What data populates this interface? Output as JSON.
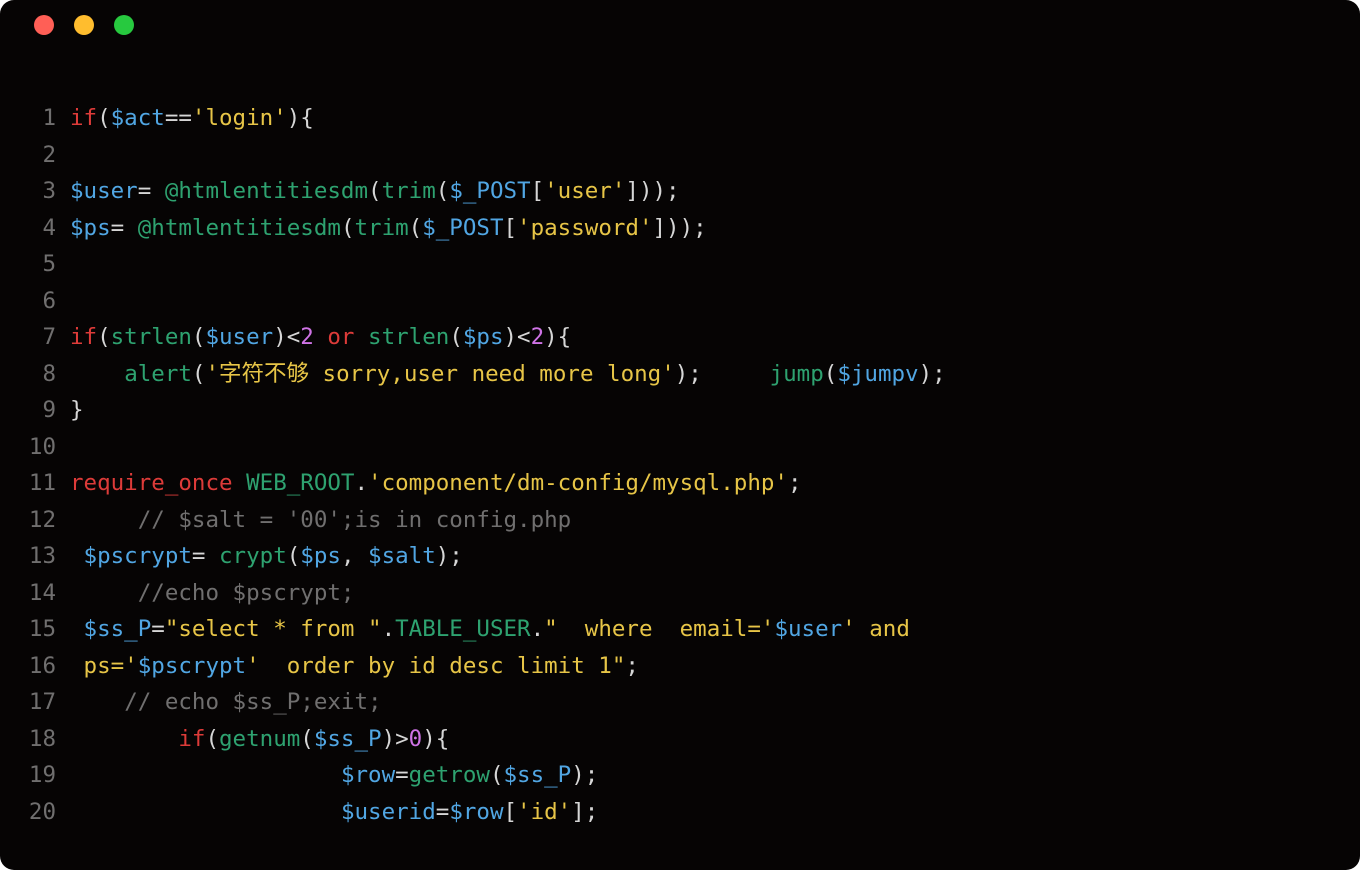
{
  "window": {
    "traffic_light": {
      "close": "red",
      "min": "yellow",
      "max": "green"
    }
  },
  "code": {
    "lines": [
      {
        "n": "1",
        "tokens": [
          [
            "kw",
            "if"
          ],
          [
            "punct",
            "("
          ],
          [
            "var",
            "$act"
          ],
          [
            "punct",
            "=="
          ],
          [
            "str",
            "'login'"
          ],
          [
            "punct",
            "){"
          ]
        ]
      },
      {
        "n": "2",
        "tokens": []
      },
      {
        "n": "3",
        "tokens": [
          [
            "var",
            "$user"
          ],
          [
            "punct",
            "= "
          ],
          [
            "at",
            "@htmlentitiesdm"
          ],
          [
            "punct",
            "("
          ],
          [
            "func",
            "trim"
          ],
          [
            "punct",
            "("
          ],
          [
            "var",
            "$_POST"
          ],
          [
            "punct",
            "["
          ],
          [
            "str",
            "'user'"
          ],
          [
            "punct",
            "]));"
          ]
        ]
      },
      {
        "n": "4",
        "tokens": [
          [
            "var",
            "$ps"
          ],
          [
            "punct",
            "= "
          ],
          [
            "at",
            "@htmlentitiesdm"
          ],
          [
            "punct",
            "("
          ],
          [
            "func",
            "trim"
          ],
          [
            "punct",
            "("
          ],
          [
            "var",
            "$_POST"
          ],
          [
            "punct",
            "["
          ],
          [
            "str",
            "'password'"
          ],
          [
            "punct",
            "]));"
          ]
        ]
      },
      {
        "n": "5",
        "tokens": []
      },
      {
        "n": "6",
        "tokens": []
      },
      {
        "n": "7",
        "tokens": [
          [
            "kw",
            "if"
          ],
          [
            "punct",
            "("
          ],
          [
            "func",
            "strlen"
          ],
          [
            "punct",
            "("
          ],
          [
            "var",
            "$user"
          ],
          [
            "punct",
            ")<"
          ],
          [
            "num",
            "2"
          ],
          [
            "plain",
            " "
          ],
          [
            "kw",
            "or"
          ],
          [
            "plain",
            " "
          ],
          [
            "func",
            "strlen"
          ],
          [
            "punct",
            "("
          ],
          [
            "var",
            "$ps"
          ],
          [
            "punct",
            ")<"
          ],
          [
            "num",
            "2"
          ],
          [
            "punct",
            "){"
          ]
        ]
      },
      {
        "n": "8",
        "tokens": [
          [
            "plain",
            "    "
          ],
          [
            "func",
            "alert"
          ],
          [
            "punct",
            "("
          ],
          [
            "str",
            "'字符不够 sorry,user need more long'"
          ],
          [
            "punct",
            ");     "
          ],
          [
            "func",
            "jump"
          ],
          [
            "punct",
            "("
          ],
          [
            "var",
            "$jumpv"
          ],
          [
            "punct",
            ");"
          ]
        ]
      },
      {
        "n": "9",
        "tokens": [
          [
            "punct",
            "}"
          ]
        ]
      },
      {
        "n": "10",
        "tokens": []
      },
      {
        "n": "11",
        "tokens": [
          [
            "kw",
            "require_once"
          ],
          [
            "plain",
            " "
          ],
          [
            "const",
            "WEB_ROOT"
          ],
          [
            "punct",
            "."
          ],
          [
            "str",
            "'component/dm-config/mysql.php'"
          ],
          [
            "punct",
            ";"
          ]
        ]
      },
      {
        "n": "12",
        "tokens": [
          [
            "plain",
            "     "
          ],
          [
            "cmt",
            "// $salt = '00';is in config.php"
          ]
        ]
      },
      {
        "n": "13",
        "tokens": [
          [
            "plain",
            " "
          ],
          [
            "var",
            "$pscrypt"
          ],
          [
            "punct",
            "= "
          ],
          [
            "func",
            "crypt"
          ],
          [
            "punct",
            "("
          ],
          [
            "var",
            "$ps"
          ],
          [
            "punct",
            ", "
          ],
          [
            "var",
            "$salt"
          ],
          [
            "punct",
            ");"
          ]
        ]
      },
      {
        "n": "14",
        "tokens": [
          [
            "plain",
            "     "
          ],
          [
            "cmt",
            "//echo $pscrypt;"
          ]
        ]
      },
      {
        "n": "15",
        "tokens": [
          [
            "plain",
            " "
          ],
          [
            "var",
            "$ss_P"
          ],
          [
            "punct",
            "="
          ],
          [
            "str",
            "\"select * from \""
          ],
          [
            "punct",
            "."
          ],
          [
            "const",
            "TABLE_USER"
          ],
          [
            "punct",
            "."
          ],
          [
            "str",
            "\"  where  email='"
          ],
          [
            "var",
            "$user"
          ],
          [
            "str",
            "' and "
          ]
        ]
      },
      {
        "n": "16",
        "tokens": [
          [
            "plain",
            " "
          ],
          [
            "str",
            "ps='"
          ],
          [
            "var",
            "$pscrypt"
          ],
          [
            "str",
            "'  order by id desc limit 1\""
          ],
          [
            "punct",
            ";"
          ]
        ]
      },
      {
        "n": "17",
        "tokens": [
          [
            "plain",
            "    "
          ],
          [
            "cmt",
            "// echo $ss_P;exit;"
          ]
        ]
      },
      {
        "n": "18",
        "tokens": [
          [
            "plain",
            "        "
          ],
          [
            "kw",
            "if"
          ],
          [
            "punct",
            "("
          ],
          [
            "func",
            "getnum"
          ],
          [
            "punct",
            "("
          ],
          [
            "var",
            "$ss_P"
          ],
          [
            "punct",
            ")>"
          ],
          [
            "num",
            "0"
          ],
          [
            "punct",
            "){"
          ]
        ]
      },
      {
        "n": "19",
        "tokens": [
          [
            "plain",
            "                    "
          ],
          [
            "var",
            "$row"
          ],
          [
            "punct",
            "="
          ],
          [
            "func",
            "getrow"
          ],
          [
            "punct",
            "("
          ],
          [
            "var",
            "$ss_P"
          ],
          [
            "punct",
            ");"
          ]
        ]
      },
      {
        "n": "20",
        "tokens": [
          [
            "plain",
            "                    "
          ],
          [
            "var",
            "$userid"
          ],
          [
            "punct",
            "="
          ],
          [
            "var",
            "$row"
          ],
          [
            "punct",
            "["
          ],
          [
            "str",
            "'id'"
          ],
          [
            "punct",
            "];"
          ]
        ]
      }
    ]
  }
}
